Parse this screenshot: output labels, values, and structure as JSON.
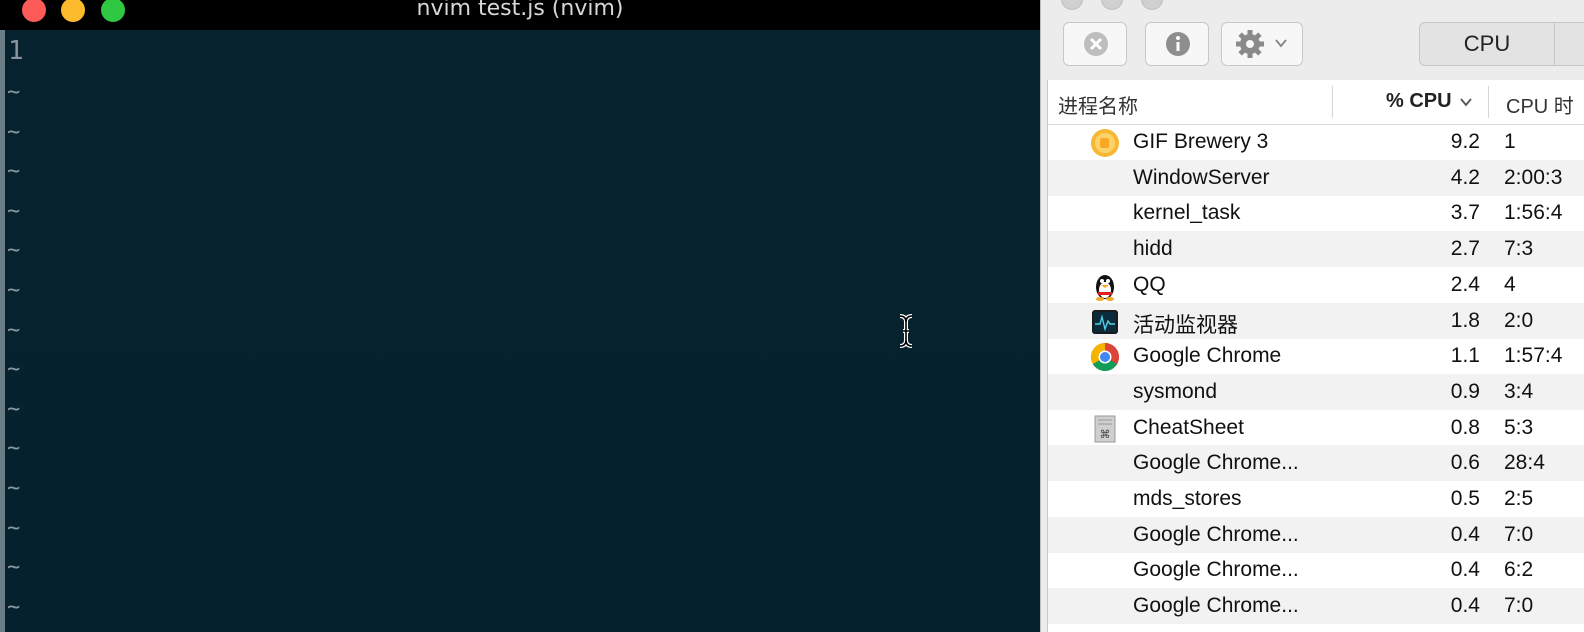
{
  "terminal": {
    "title": "nvim test.js (nvim)",
    "line_number": "1",
    "tilde": "~"
  },
  "activity_monitor": {
    "toolbar": {
      "stop_icon": "stop-process-icon",
      "info_icon": "info-icon",
      "gear_icon": "gear-icon",
      "active_tab": "CPU"
    },
    "columns": {
      "name": "进程名称",
      "cpu": "% CPU",
      "cpu_time": "CPU 时"
    },
    "rows": [
      {
        "name": "GIF Brewery 3",
        "cpu": "9.2",
        "time": "1",
        "icon": "gif-brewery-icon"
      },
      {
        "name": "WindowServer",
        "cpu": "4.2",
        "time": "2:00:3",
        "icon": ""
      },
      {
        "name": "kernel_task",
        "cpu": "3.7",
        "time": "1:56:4",
        "icon": ""
      },
      {
        "name": "hidd",
        "cpu": "2.7",
        "time": "7:3",
        "icon": ""
      },
      {
        "name": "QQ",
        "cpu": "2.4",
        "time": "4",
        "icon": "qq-penguin-icon"
      },
      {
        "name": "活动监视器",
        "cpu": "1.8",
        "time": "2:0",
        "icon": "activity-monitor-icon"
      },
      {
        "name": "Google Chrome",
        "cpu": "1.1",
        "time": "1:57:4",
        "icon": "chrome-icon"
      },
      {
        "name": "sysmond",
        "cpu": "0.9",
        "time": "3:4",
        "icon": ""
      },
      {
        "name": "CheatSheet",
        "cpu": "0.8",
        "time": "5:3",
        "icon": "cheatsheet-icon"
      },
      {
        "name": "Google Chrome...",
        "cpu": "0.6",
        "time": "28:4",
        "icon": ""
      },
      {
        "name": "mds_stores",
        "cpu": "0.5",
        "time": "2:5",
        "icon": ""
      },
      {
        "name": "Google Chrome...",
        "cpu": "0.4",
        "time": "7:0",
        "icon": ""
      },
      {
        "name": "Google Chrome...",
        "cpu": "0.4",
        "time": "6:2",
        "icon": ""
      },
      {
        "name": "Google Chrome...",
        "cpu": "0.4",
        "time": "7:0",
        "icon": ""
      }
    ]
  }
}
